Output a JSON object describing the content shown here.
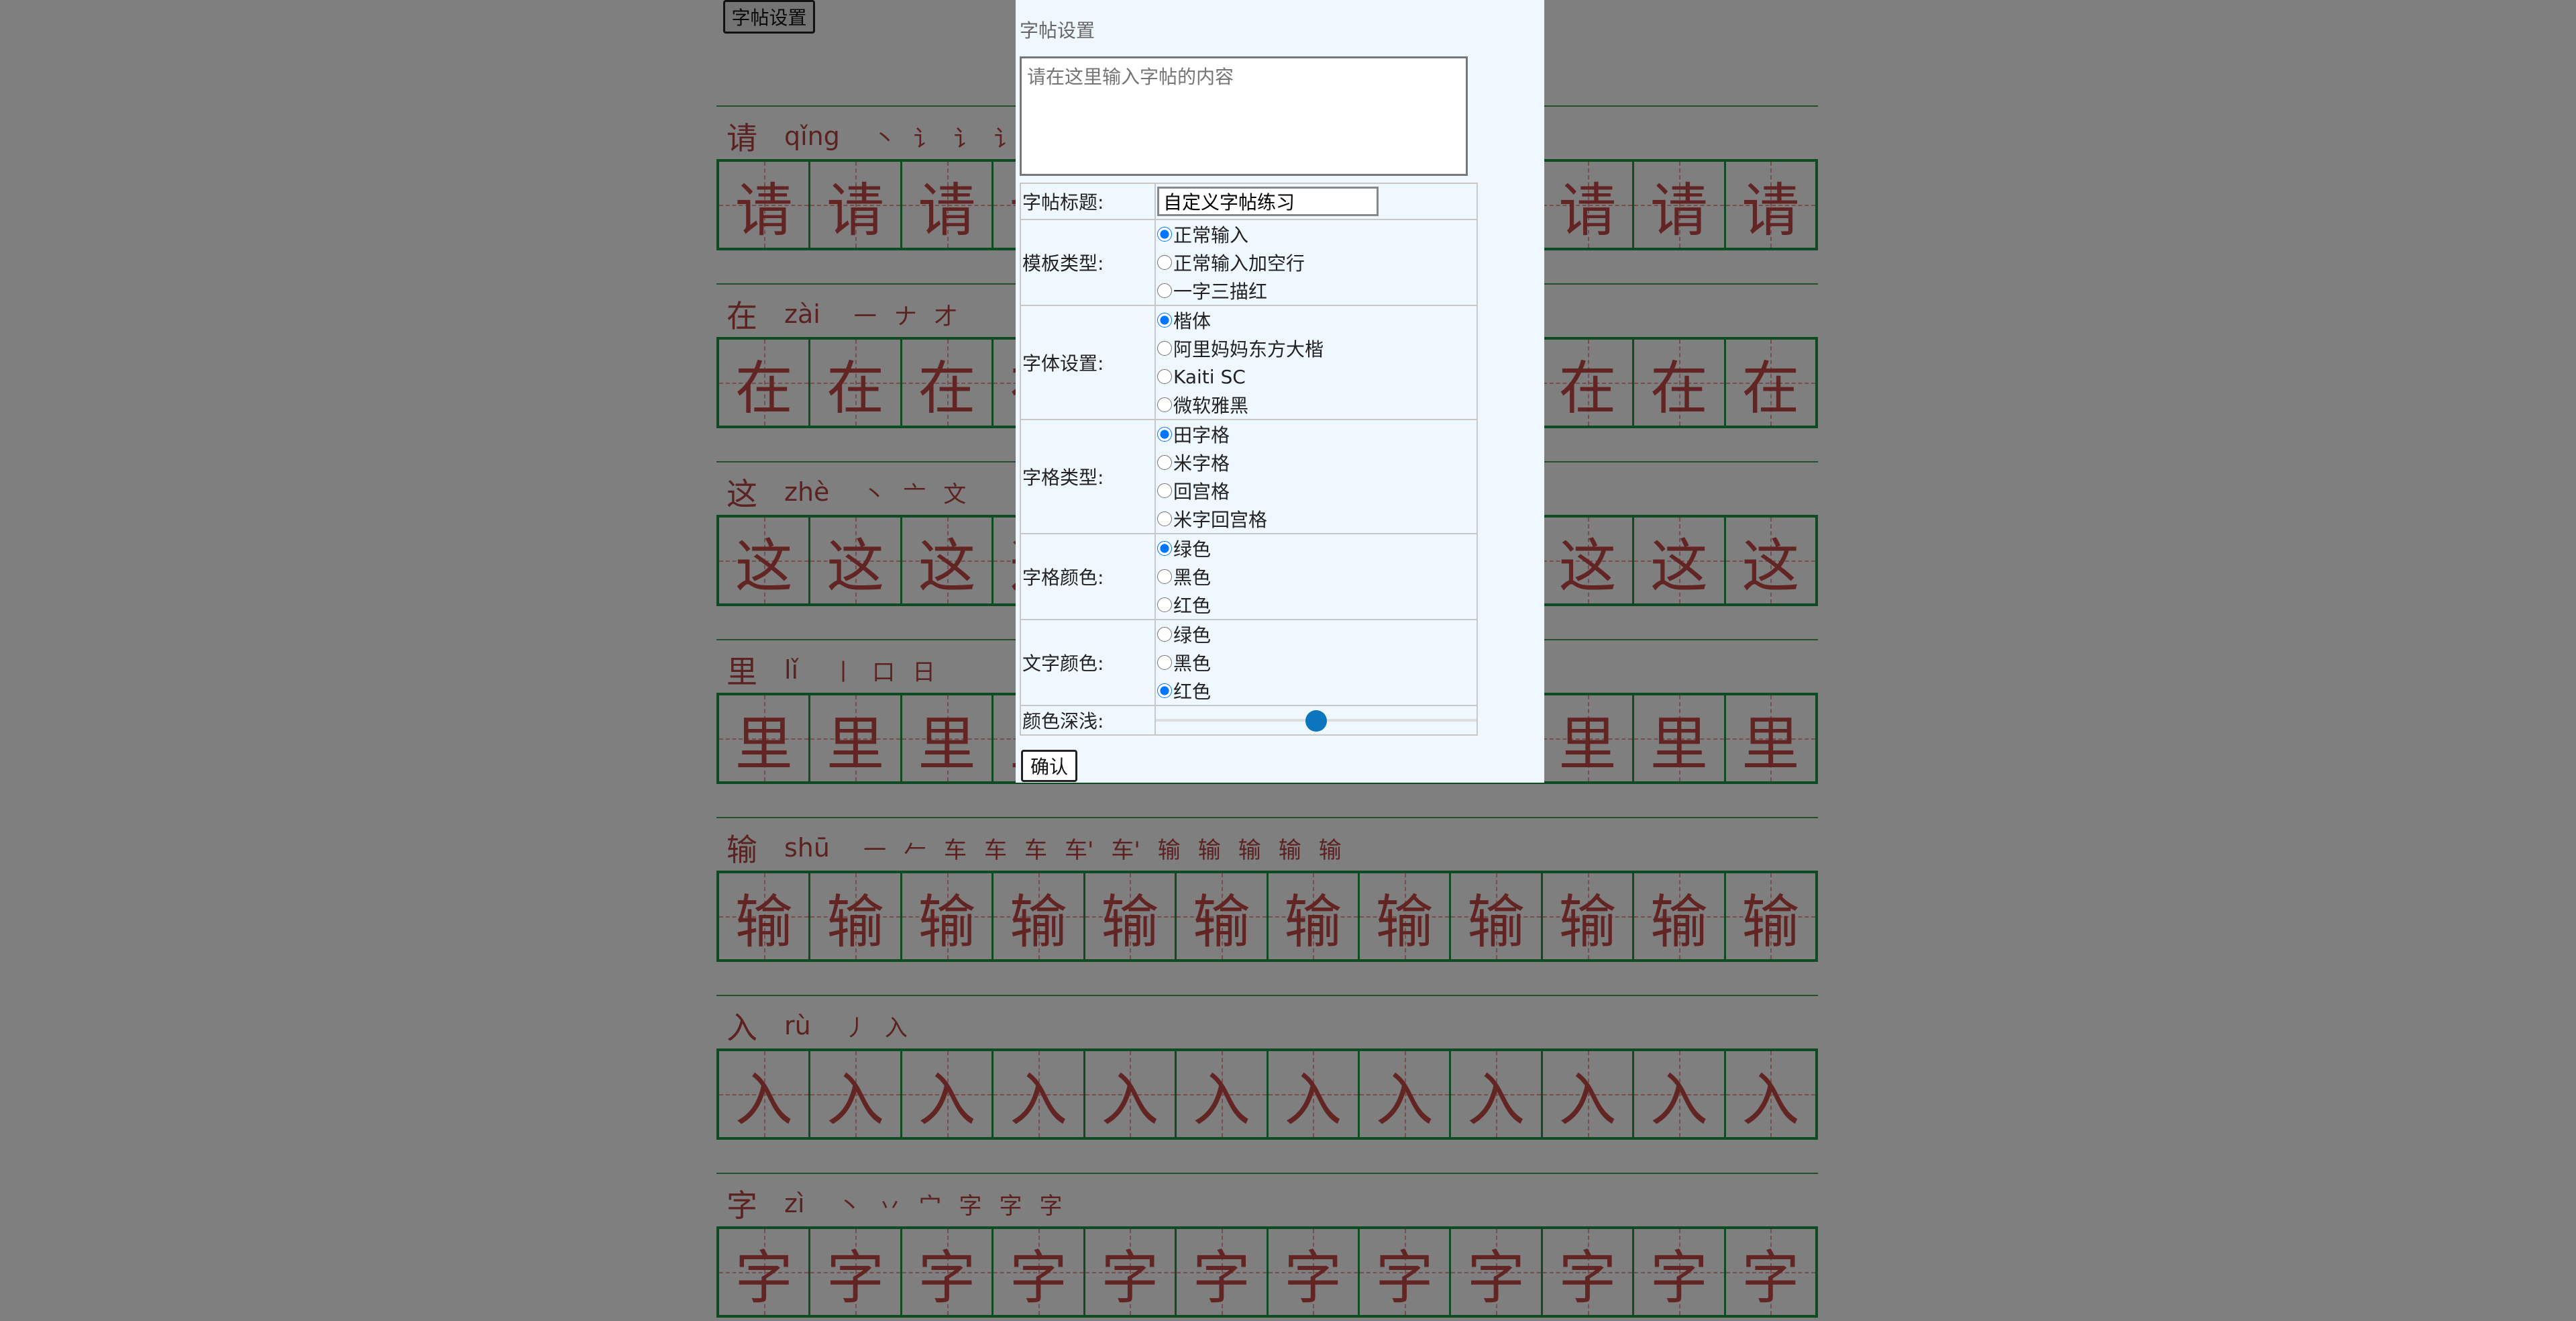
{
  "toolbar": {
    "settings_button": "字帖设置"
  },
  "sheet_rows": [
    {
      "char": "请",
      "pinyin": "qǐng",
      "strokes": [
        "丶",
        "讠",
        "讠",
        "讠"
      ]
    },
    {
      "char": "在",
      "pinyin": "zài",
      "strokes": [
        "一",
        "ナ",
        "才"
      ]
    },
    {
      "char": "这",
      "pinyin": "zhè",
      "strokes": [
        "丶",
        "亠",
        "文"
      ]
    },
    {
      "char": "里",
      "pinyin": "lǐ",
      "strokes": [
        "丨",
        "口",
        "日"
      ]
    },
    {
      "char": "输",
      "pinyin": "shū",
      "strokes": [
        "一",
        "𠂉",
        "车",
        "车",
        "车",
        "车'",
        "车'",
        "输",
        "输",
        "输",
        "输",
        "输"
      ]
    },
    {
      "char": "入",
      "pinyin": "rù",
      "strokes": [
        "丿",
        "入"
      ]
    },
    {
      "char": "字",
      "pinyin": "zì",
      "strokes": [
        "丶",
        "丷",
        "宀",
        "字",
        "字",
        "字"
      ]
    }
  ],
  "dialog": {
    "title": "字帖设置",
    "content_placeholder": "请在这里输入字帖的内容",
    "confirm_label": "确认",
    "rows": [
      {
        "label": "字帖标题:",
        "type": "text",
        "value": "自定义字帖练习"
      },
      {
        "label": "模板类型:",
        "type": "radio",
        "group": "template",
        "options": [
          "正常输入",
          "正常输入加空行",
          "一字三描红"
        ],
        "selected": 0
      },
      {
        "label": "字体设置:",
        "type": "radio",
        "group": "font",
        "options": [
          "楷体",
          "阿里妈妈东方大楷",
          "Kaiti SC",
          "微软雅黑"
        ],
        "selected": 0
      },
      {
        "label": "字格类型:",
        "type": "radio",
        "group": "gridtype",
        "options": [
          "田字格",
          "米字格",
          "回宫格",
          "米字回宫格"
        ],
        "selected": 0
      },
      {
        "label": "字格颜色:",
        "type": "radio",
        "group": "gridcolor",
        "options": [
          "绿色",
          "黑色",
          "红色"
        ],
        "selected": 0
      },
      {
        "label": "文字颜色:",
        "type": "radio",
        "group": "textcolor",
        "options": [
          "绿色",
          "黑色",
          "红色"
        ],
        "selected": 2
      },
      {
        "label": "颜色深浅:",
        "type": "slider",
        "value": 0.5
      }
    ]
  },
  "colors": {
    "grid": "#1f9645",
    "text": "#c64949",
    "overlay": "rgba(0,0,0,0.5)",
    "accent": "#0b76bd"
  }
}
